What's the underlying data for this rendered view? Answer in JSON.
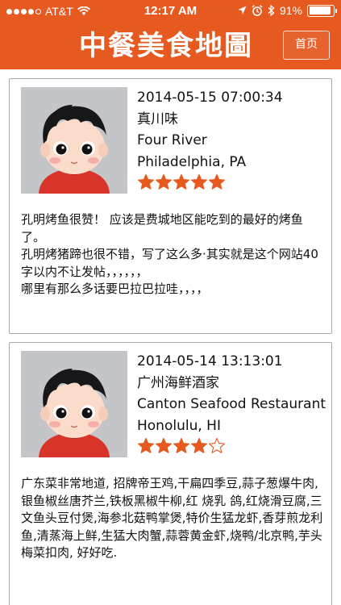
{
  "status_bar": {
    "carrier": "AT&T",
    "time": "12:17 AM",
    "battery_text": "91%",
    "battery_level": 0.91,
    "signal_bars_filled": 4,
    "signal_bars_total": 5
  },
  "nav": {
    "title": "中餐美食地圖",
    "home_label": "首页"
  },
  "colors": {
    "brand": "#e65a20",
    "star": "#e65a20"
  },
  "reviews": [
    {
      "datetime": "2014-05-15 07:00:34",
      "name_zh": "真川味",
      "name_en": "Four River",
      "location": "Philadelphia, PA",
      "rating": 5,
      "max_rating": 5,
      "text_lines": [
        "孔明烤鱼很赞！ 应该是费城地区能吃到的最好的烤鱼了。",
        "孔明烤猪蹄也很不错，写了这么多·其实就是这个网站40字以内不让发帖，，，，，，",
        "哪里有那么多话要巴拉巴拉哇，，，，"
      ]
    },
    {
      "datetime": "2014-05-14 13:13:01",
      "name_zh": "广州海鲜酒家",
      "name_en": "Canton Seafood Restaurant",
      "location": "Honolulu, HI",
      "rating": 4,
      "max_rating": 5,
      "text_lines": [
        "广东菜非常地道, 招牌帝王鸡,干扁四季豆,蒜子葱爆牛肉,银鱼椒丝唐芥兰,铁板黑椒牛柳,红 烧乳 鸽,红烧滑豆腐,三文鱼头豆付煲,海参北菇鸭掌煲,特价生猛龙虾,香芽煎龙利鱼,清蒸海上鲜,生猛大肉蟹,蒜蓉黄金虾,烧鸭/北京鸭,芋头梅菜扣肉, 好好吃."
      ]
    }
  ]
}
